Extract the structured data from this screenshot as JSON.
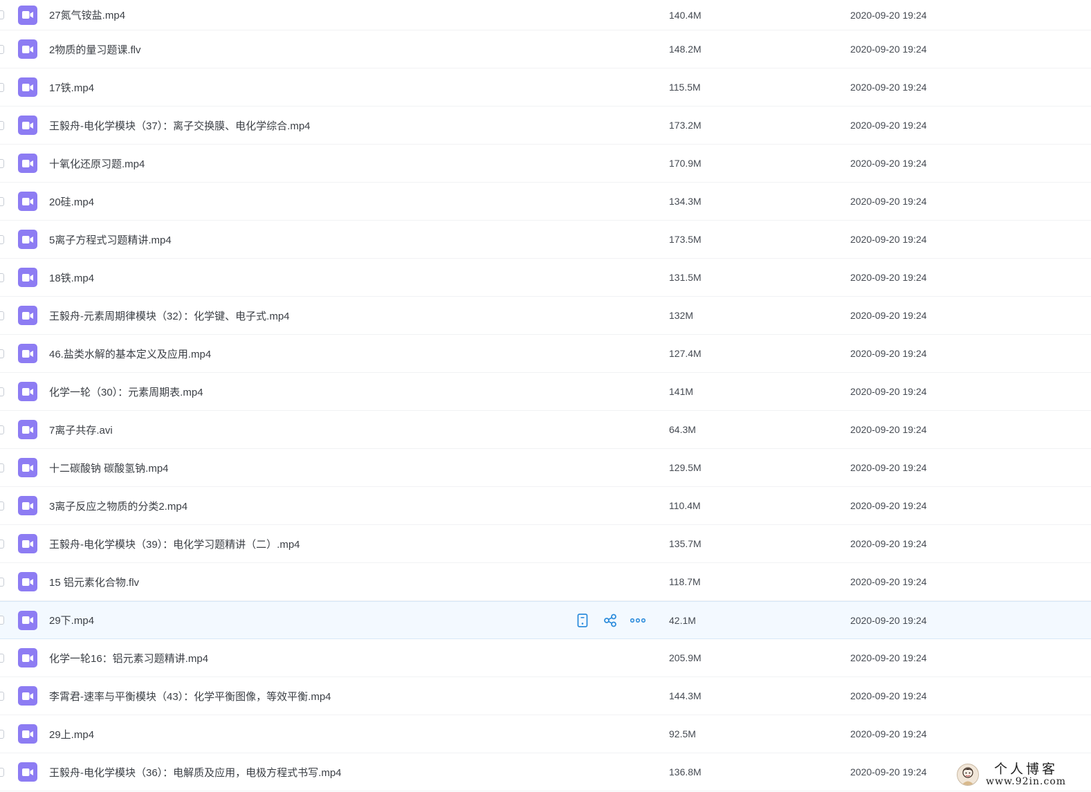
{
  "files": [
    {
      "name": "27氮气铵盐.mp4",
      "size": "140.4M",
      "date": "2020-09-20 19:24"
    },
    {
      "name": "2物质的量习题课.flv",
      "size": "148.2M",
      "date": "2020-09-20 19:24"
    },
    {
      "name": "17铁.mp4",
      "size": "115.5M",
      "date": "2020-09-20 19:24"
    },
    {
      "name": "王毅舟-电化学模块（37）：离子交换膜、电化学综合.mp4",
      "size": "173.2M",
      "date": "2020-09-20 19:24"
    },
    {
      "name": "十氧化还原习题.mp4",
      "size": "170.9M",
      "date": "2020-09-20 19:24"
    },
    {
      "name": "20硅.mp4",
      "size": "134.3M",
      "date": "2020-09-20 19:24"
    },
    {
      "name": "5离子方程式习题精讲.mp4",
      "size": "173.5M",
      "date": "2020-09-20 19:24"
    },
    {
      "name": "18铁.mp4",
      "size": "131.5M",
      "date": "2020-09-20 19:24"
    },
    {
      "name": "王毅舟-元素周期律模块（32）：化学键、电子式.mp4",
      "size": "132M",
      "date": "2020-09-20 19:24"
    },
    {
      "name": "46.盐类水解的基本定义及应用.mp4",
      "size": "127.4M",
      "date": "2020-09-20 19:24"
    },
    {
      "name": "化学一轮（30）：元素周期表.mp4",
      "size": "141M",
      "date": "2020-09-20 19:24"
    },
    {
      "name": "7离子共存.avi",
      "size": "64.3M",
      "date": "2020-09-20 19:24"
    },
    {
      "name": "十二碳酸钠 碳酸氢钠.mp4",
      "size": "129.5M",
      "date": "2020-09-20 19:24"
    },
    {
      "name": "3离子反应之物质的分类2.mp4",
      "size": "110.4M",
      "date": "2020-09-20 19:24"
    },
    {
      "name": "王毅舟-电化学模块（39）：电化学习题精讲（二）.mp4",
      "size": "135.7M",
      "date": "2020-09-20 19:24"
    },
    {
      "name": "15 铝元素化合物.flv",
      "size": "118.7M",
      "date": "2020-09-20 19:24"
    },
    {
      "name": "29下.mp4",
      "size": "42.1M",
      "date": "2020-09-20 19:24"
    },
    {
      "name": "化学一轮16：铝元素习题精讲.mp4",
      "size": "205.9M",
      "date": "2020-09-20 19:24"
    },
    {
      "name": "李霄君-速率与平衡模块（43）：化学平衡图像，等效平衡.mp4",
      "size": "144.3M",
      "date": "2020-09-20 19:24"
    },
    {
      "name": "29上.mp4",
      "size": "92.5M",
      "date": "2020-09-20 19:24"
    },
    {
      "name": "王毅舟-电化学模块（36）：电解质及应用，电极方程式书写.mp4",
      "size": "136.8M",
      "date": "2020-09-20 19:24"
    }
  ],
  "hovered_row_actions": [
    "phone-icon",
    "share-icon",
    "more-icon"
  ],
  "icons": {
    "file_type": "video-camera-icon"
  },
  "colors": {
    "file_icon": "#8d7cf3",
    "action_icon": "#2e8ddc",
    "hover_row": "#f3f9ff"
  },
  "watermark": {
    "title": "个人博客",
    "url": "www.92in.com"
  }
}
